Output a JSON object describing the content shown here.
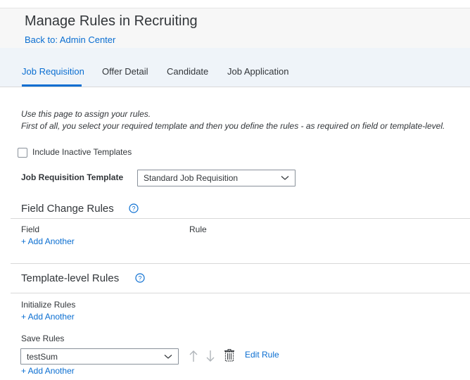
{
  "header": {
    "title": "Manage Rules in Recruiting",
    "back_link": "Back to: Admin Center"
  },
  "tabs": [
    {
      "label": "Job Requisition",
      "active": true
    },
    {
      "label": "Offer Detail",
      "active": false
    },
    {
      "label": "Candidate",
      "active": false
    },
    {
      "label": "Job Application",
      "active": false
    }
  ],
  "intro": {
    "line1": "Use this page to assign your rules.",
    "line2": "First of all, you select your required template and then you define the rules - as required on field or template-level."
  },
  "include_inactive": {
    "label": "Include Inactive Templates",
    "checked": false
  },
  "template_select": {
    "label": "Job Requisition Template",
    "value": "Standard Job Requisition"
  },
  "field_change": {
    "title": "Field Change Rules",
    "col_field": "Field",
    "col_rule": "Rule",
    "add_link": "+ Add Another"
  },
  "template_level": {
    "title": "Template-level Rules",
    "initialize_label": "Initialize Rules",
    "initialize_add": "+ Add Another",
    "save_label": "Save Rules",
    "save_value": "testSum",
    "edit_rule": "Edit Rule",
    "save_add": "+ Add Another"
  },
  "colors": {
    "accent": "#0a6ed1",
    "text": "#32363a",
    "tabbar_bg": "#eff4f9",
    "header_bg": "#f7f7f7",
    "icon_gray": "#b0b5ba"
  }
}
